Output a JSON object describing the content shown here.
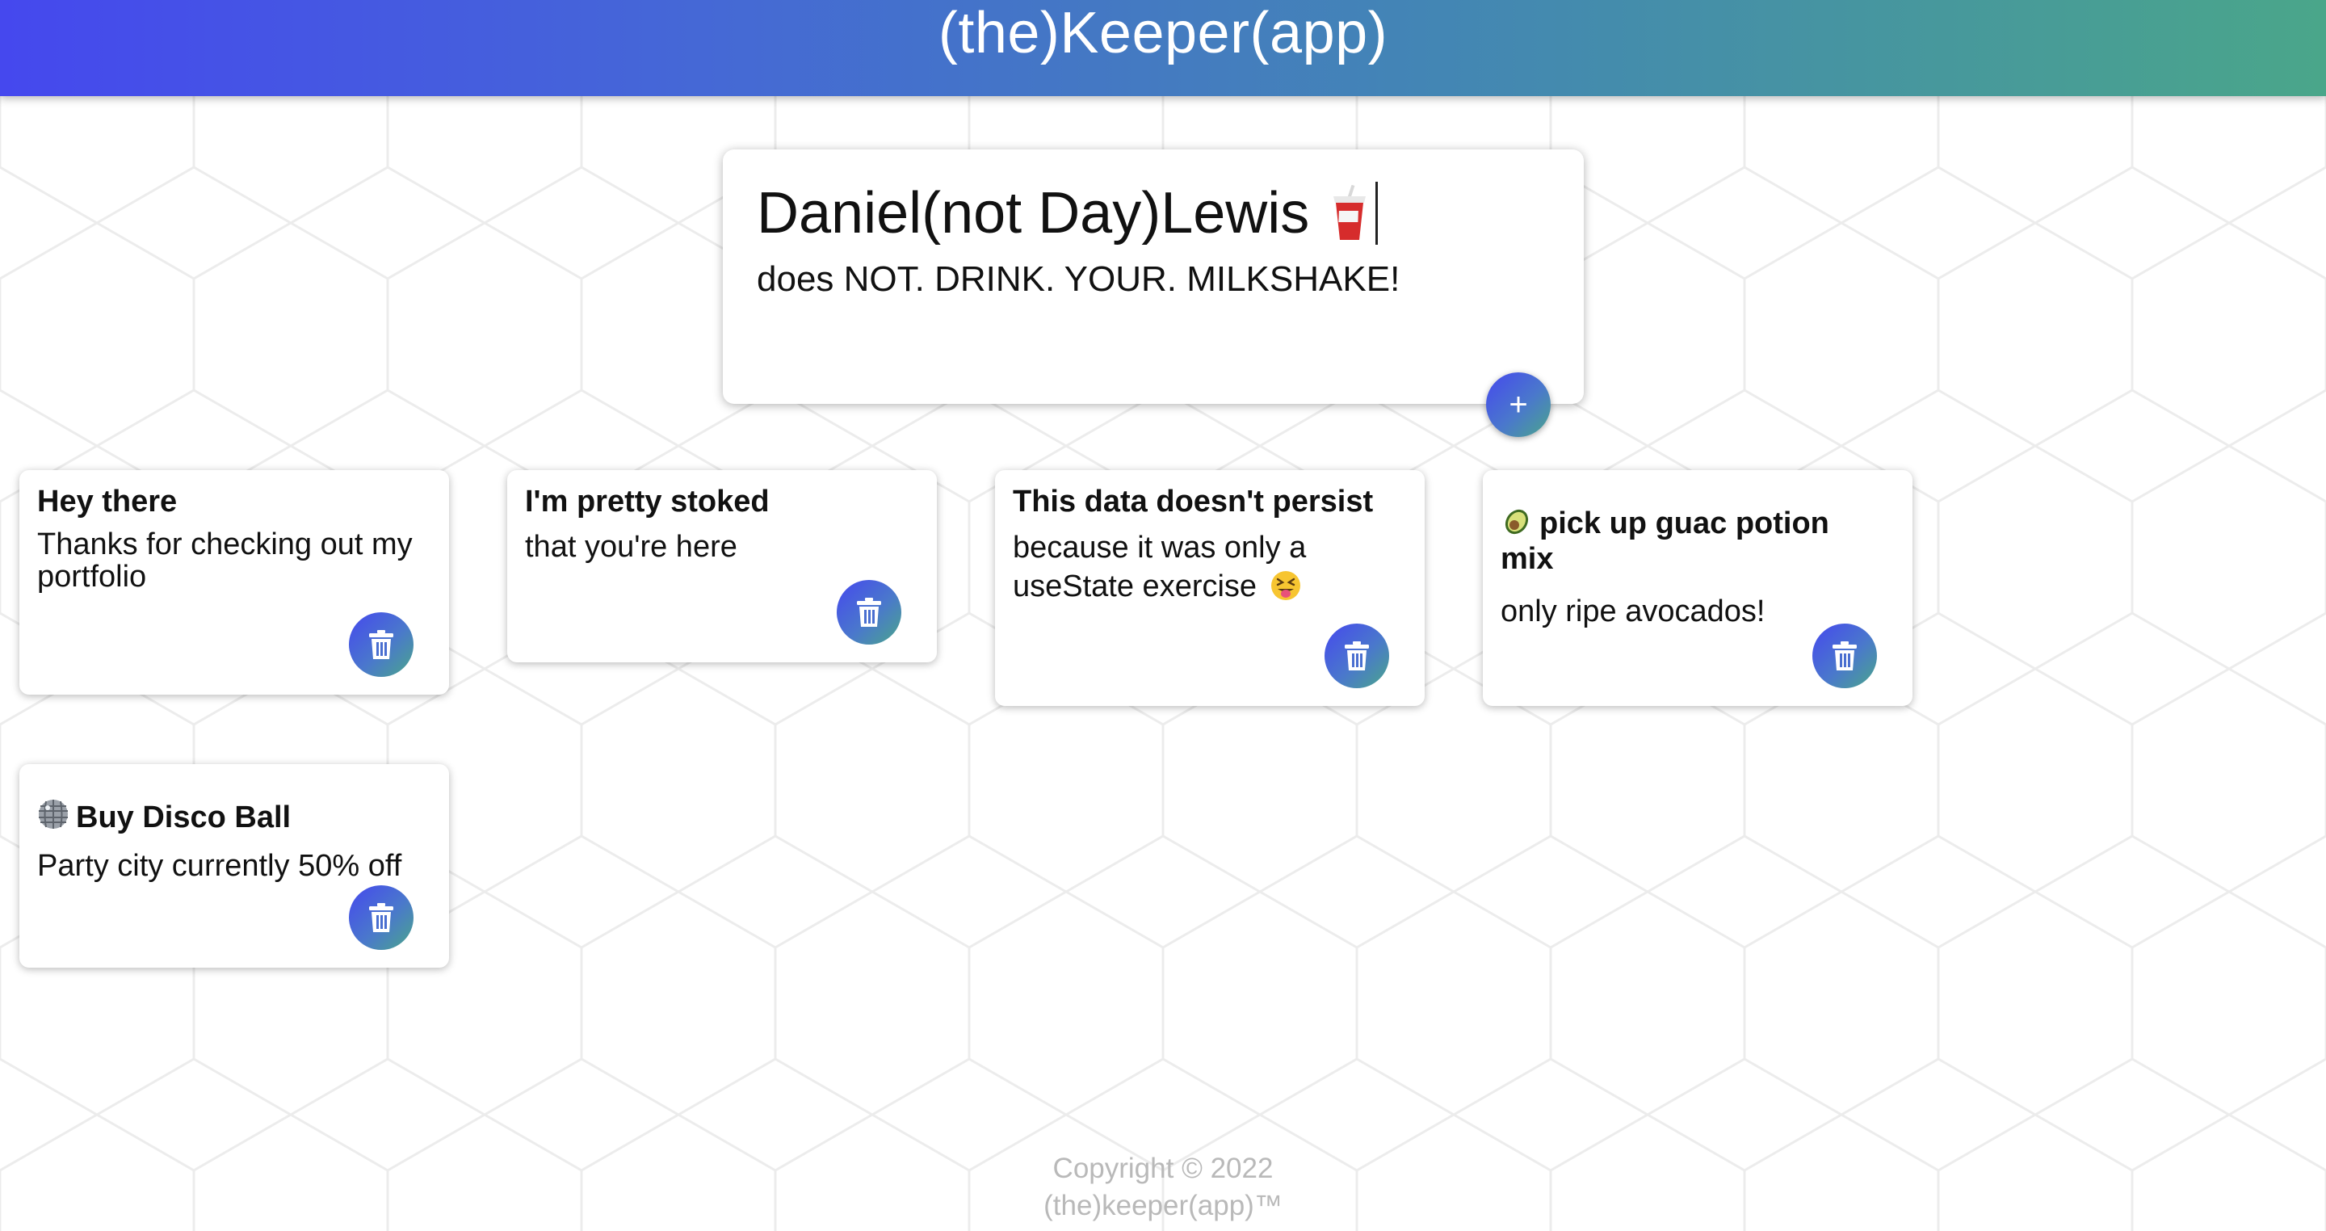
{
  "app": {
    "title": "(the)Keeper(app)"
  },
  "colors": {
    "gradient_start": "#4548ee",
    "gradient_end": "#4aa68a",
    "footer_text": "#b9b9b9"
  },
  "create_note": {
    "title_value": "Daniel(not Day)Lewis",
    "title_icon": "soda-cup-icon",
    "content_value": "does NOT. DRINK. YOUR. MILKSHAKE!",
    "add_label": "+"
  },
  "notes": [
    {
      "title": "Hey there",
      "content_line1": "Thanks for checking out my",
      "content_line2": "portfolio",
      "delete_icon": "trash-icon"
    },
    {
      "title": "I'm pretty stoked",
      "content": "that you're here",
      "delete_icon": "trash-icon"
    },
    {
      "title": "This data doesn't persist",
      "content_line1": "because it was only a",
      "content_line2": "useState exercise",
      "content_icon": "winking-tongue-face-icon",
      "delete_icon": "trash-icon"
    },
    {
      "title_icon": "avocado-icon",
      "title_line1": "pick up guac potion",
      "title_line2": "mix",
      "content": "only ripe avocados!",
      "delete_icon": "trash-icon"
    },
    {
      "title_icon": "disco-ball-icon",
      "title": "Buy Disco Ball",
      "content": "Party city currently 50% off",
      "delete_icon": "trash-icon"
    }
  ],
  "footer": {
    "line1": "Copyright © 2022",
    "line2": "(the)keeper(app)™"
  }
}
